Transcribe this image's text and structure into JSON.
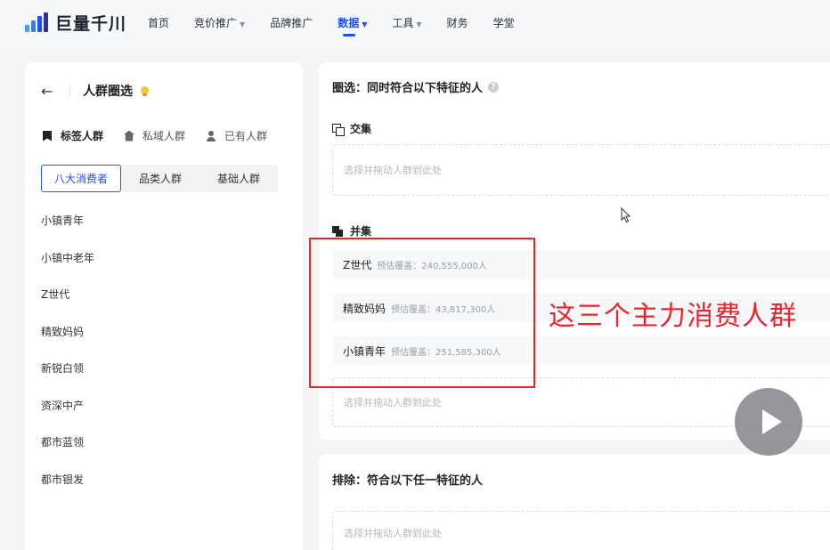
{
  "app": {
    "logo_text": "巨量千川"
  },
  "nav": [
    {
      "label": "首页",
      "caret": false,
      "active": false
    },
    {
      "label": "竞价推广",
      "caret": true,
      "active": false
    },
    {
      "label": "品牌推广",
      "caret": false,
      "active": false
    },
    {
      "label": "数据",
      "caret": true,
      "active": true
    },
    {
      "label": "工具",
      "caret": true,
      "active": false
    },
    {
      "label": "财务",
      "caret": false,
      "active": false
    },
    {
      "label": "学堂",
      "caret": false,
      "active": false
    }
  ],
  "left_panel": {
    "title": "人群圈选",
    "category_tabs": [
      {
        "label": "标签人群",
        "icon": "tag-icon",
        "active": true
      },
      {
        "label": "私域人群",
        "icon": "house-icon",
        "active": false
      },
      {
        "label": "已有人群",
        "icon": "user-icon",
        "active": false
      }
    ],
    "segments": [
      {
        "label": "八大消费者",
        "active": true
      },
      {
        "label": "品类人群",
        "active": false
      },
      {
        "label": "基础人群",
        "active": false
      }
    ],
    "audiences": [
      "小镇青年",
      "小镇中老年",
      "Z世代",
      "精致妈妈",
      "新锐白领",
      "资深中产",
      "都市蓝领",
      "都市银发"
    ]
  },
  "right_panel": {
    "title": "圈选：同时符合以下特征的人",
    "intersect_label": "交集",
    "union_label": "并集",
    "dropzone_placeholder": "选择并拖动人群到此处",
    "union_items": [
      {
        "name": "Z世代",
        "estimate": "预估覆盖：240,555,000人"
      },
      {
        "name": "精致妈妈",
        "estimate": "预估覆盖：43,817,300人"
      },
      {
        "name": "小镇青年",
        "estimate": "预估覆盖：251,585,300人"
      }
    ]
  },
  "exclude_panel": {
    "title": "排除：符合以下任一特征的人",
    "dropzone_placeholder": "选择并拖动人群到此处"
  },
  "annotation": {
    "text": "这三个主力消费人群",
    "color": "#e8262b"
  },
  "colors": {
    "accent": "#1f4ff0",
    "annotation_red": "#e6262b"
  }
}
